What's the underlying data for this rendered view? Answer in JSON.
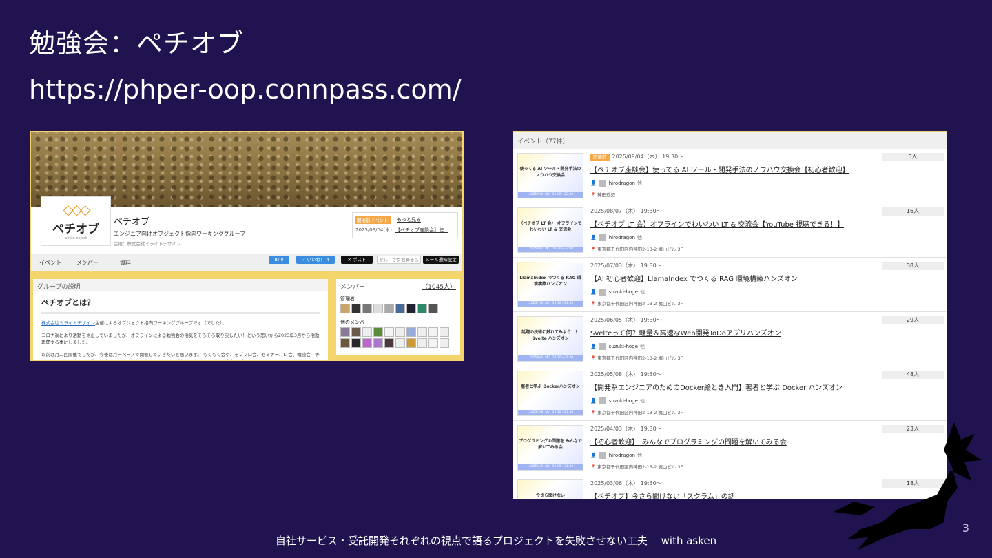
{
  "slide": {
    "title": "勉強会：ペチオブ",
    "url": "https://phper-oop.connpass.com/",
    "footer": "自社サービス・受託開発それぞれの視点で語るプロジェクトを失敗させない工夫　 with asken",
    "page_number": "3"
  },
  "group_page": {
    "logo_text": "ペチオブ",
    "logo_sub": "petite object",
    "name": "ペチオブ",
    "description": "エンジニア向けオブジェクト指向ワーキンググループ",
    "organizer": "主催：株式会社ミライトデザイン",
    "newest_event": {
      "badge": "開催前イベント",
      "more": "もっと見る",
      "date": "2025/09/04(木)",
      "title": "【ペチオブ座談会】使…"
    },
    "nav": {
      "events": "イベント",
      "members": "メンバー",
      "materials": "資料"
    },
    "buttons": {
      "hatena": "B! 0",
      "like": "✓ いいね！ 4",
      "post": "✕ ポスト",
      "join": "グループを退会する",
      "mail": "メール通知設定"
    },
    "about": {
      "header": "グループの説明",
      "heading": "ペチオブとは？",
      "p1_link": "株式会社ミライトデザイン",
      "p1_rest": "主催によるオブジェクト指向ワーキンググループです（でした）。",
      "p2": "コロナ禍により活動を休止していましたが、オフラインによる勉強会の活気をそろそろ取り戻したい！という思いから2023年3月から活動再開する事にしました。",
      "p3": "以前は月二回開催でしたが、今後は月一ペースで開催していきたいと思います。 もくもく会や、モブプロ会、セミナー、LT会、輪読会　等をオフライン開催しつつ動画配信も並行して行う予定ですのでぜひご参加下さい！ ちなみに名前に反して特にPHP限"
    },
    "members": {
      "header": "メンバー",
      "count": "（1045人）",
      "admins_label": "管理者",
      "others_label": "他のメンバー"
    }
  },
  "events_page": {
    "header": "イベント（77件）",
    "badge_label": "開催前",
    "suffix_label": "他",
    "events": [
      {
        "date": "2025/09/04（木） 19:30〜",
        "title": "【ペチオブ座談会】使ってる AI ツール・開発手法のノウハウ交換会【初心者歓迎】",
        "user": "hirodragon",
        "place": "神田近辺",
        "count": "5人",
        "thumb": "使ってる AI ツール・開発手法の ノウハウ交換会",
        "thumb_date": "2025/9/4（木）19:30〜22:00"
      },
      {
        "date": "2025/08/07（木） 19:30〜",
        "title": "【ペチオブ LT 会】オフラインでわいわい LT & 交流会【YouTube 視聴できる！】",
        "user": "hirodragon",
        "place": "東京都千代田区内神田2-13-2 梶山ビル 3F",
        "count": "16人",
        "thumb": "〈ペチオブ LT 会〉 オフラインでわいわい LT & 交流会",
        "thumb_date": "2025/8/7（木）19:30〜22:00"
      },
      {
        "date": "2025/07/03（木） 19:30〜",
        "title": "【AI 初心者歓迎】LlamaIndex でつくる RAG 環境構築ハンズオン",
        "user": "suzuki-hoge",
        "place": "東京都千代田区内神田2-13-2 梶山ビル 3F",
        "count": "38人",
        "thumb": "LlamaIndex でつくる RAG 環境構築ハンズオン",
        "thumb_date": "2025/7/3（木）19:30〜21:30"
      },
      {
        "date": "2025/06/05（木） 19:30〜",
        "title": "Svelteって何？軽量＆高速なWeb開発ToDoアプリハンズオン",
        "user": "suzuki-hoge",
        "place": "東京都千代田区内神田2-13-2 梶山ビル 3F",
        "count": "29人",
        "thumb": "話題の技術に触れてみよう！！ Svelte ハンズオン",
        "thumb_date": "2025/6/5（木）19:30〜21:30"
      },
      {
        "date": "2025/05/08（木） 19:30〜",
        "title": "【開発系エンジニアのためのDocker絵とき入門】著者と学ぶ Docker ハンズオン",
        "user": "suzuki-hoge",
        "place": "東京都千代田区内神田2-13-2 梶山ビル 3F",
        "count": "48人",
        "thumb": "著者と学ぶ Dockerハンズオン",
        "thumb_date": "2025/5/8（木）19:30〜21:30"
      },
      {
        "date": "2025/04/03（木） 19:30〜",
        "title": "【初心者歓迎】　みんなでプログラミングの問題を解いてみる会",
        "user": "hirodragon",
        "place": "東京都千代田区内神田2-13-2 梶山ビル 3F",
        "count": "23人",
        "thumb": "プログラミングの問題を みんなで解いてみる会",
        "thumb_date": "2025/4/3（木）19:30〜21:30"
      },
      {
        "date": "2025/03/06（木） 19:30〜",
        "title": "【ペチオブ】今さら聞けない「スクラム」の話",
        "user": "",
        "place": "",
        "count": "18人",
        "thumb": "今さら聞けない",
        "thumb_date": ""
      }
    ]
  },
  "colors": {
    "background": "#20134f",
    "accent": "#f3d56b",
    "badge": "#f3a94a"
  }
}
